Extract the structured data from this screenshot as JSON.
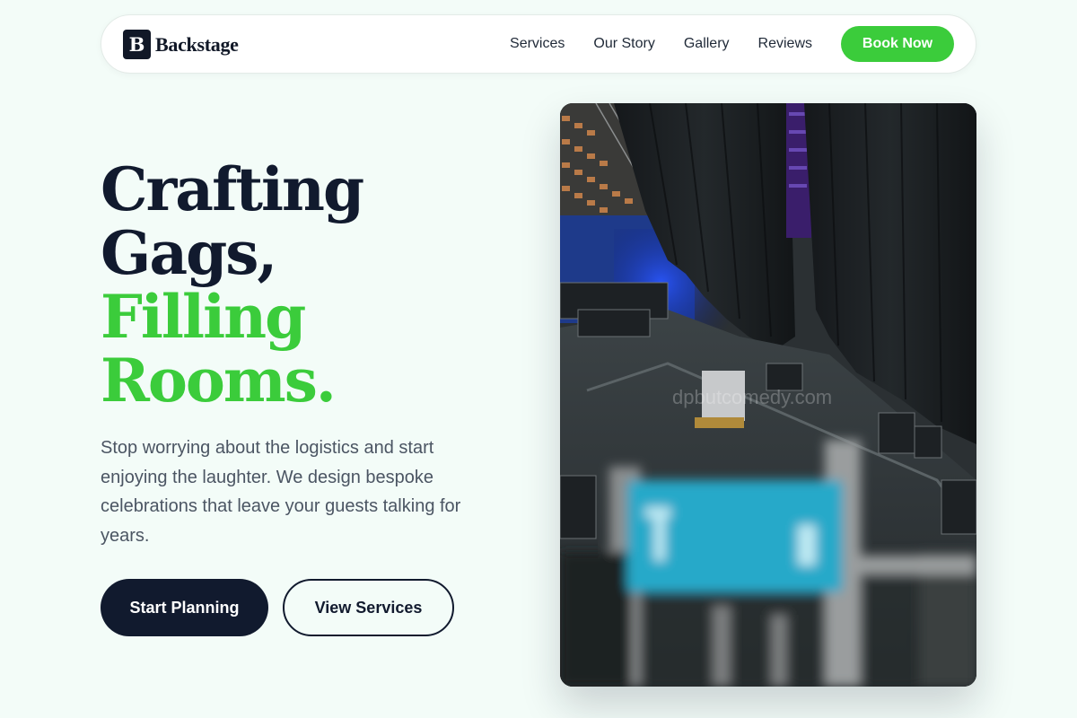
{
  "brand": {
    "mark": "B",
    "name": "Backstage"
  },
  "nav": {
    "links": [
      "Services",
      "Our Story",
      "Gallery",
      "Reviews"
    ],
    "cta": "Book Now"
  },
  "hero": {
    "title_dark": [
      "Crafting",
      "Gags,"
    ],
    "title_green": [
      "Filling",
      "Rooms."
    ],
    "description": "Stop worrying about the logistics and start enjoying the laughter. We design bespoke celebrations that leave your guests talking for years.",
    "primary_button": "Start Planning",
    "secondary_button": "View Services"
  },
  "image": {
    "subject": "venue-stage-photo",
    "watermark": "dpbutcomedy.com"
  },
  "colors": {
    "accent": "#3bcc3b",
    "dark": "#111a2e",
    "background": "#f3fcf8"
  }
}
